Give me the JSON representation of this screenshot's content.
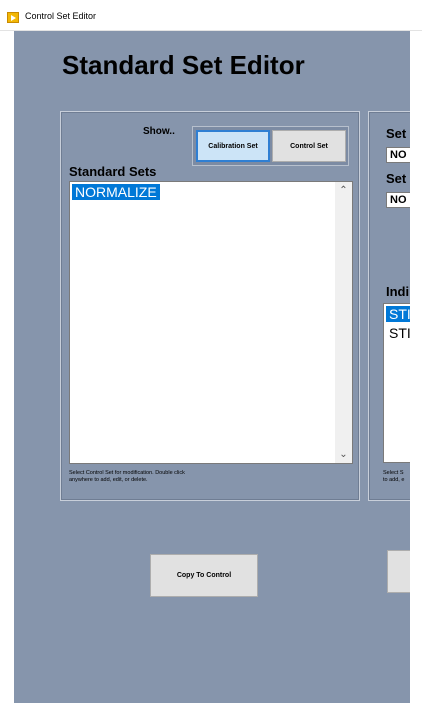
{
  "window": {
    "title": "Control Set Editor",
    "icon": "app-icon"
  },
  "page": {
    "title": "Standard Set Editor"
  },
  "left_panel": {
    "show_label": "Show..",
    "toggle": {
      "calibration_label": "Calibration Set",
      "control_label": "Control Set",
      "selected": "Calibration Set"
    },
    "list_label": "Standard Sets",
    "items": [
      {
        "label": "NORMALIZE",
        "selected": true
      }
    ],
    "hint_line1": "Select Control Set for modification.  Double click",
    "hint_line2": "anywhere to add, edit, or delete."
  },
  "right_panel": {
    "field1_label": "Set",
    "field1_value": "NO",
    "field2_label": "Set",
    "field2_value": "NO",
    "list_label": "Indi",
    "items": [
      {
        "label": "STI",
        "selected": true
      },
      {
        "label": "STI",
        "selected": false
      }
    ],
    "hint_line1": "Select S",
    "hint_line2": "to add, e"
  },
  "buttons": {
    "copy_to_control": "Copy To Control"
  },
  "colors": {
    "background": "#8695ac",
    "selection": "#0078d7",
    "active_toggle": "#cce4f7",
    "button": "#e1e1e1"
  }
}
